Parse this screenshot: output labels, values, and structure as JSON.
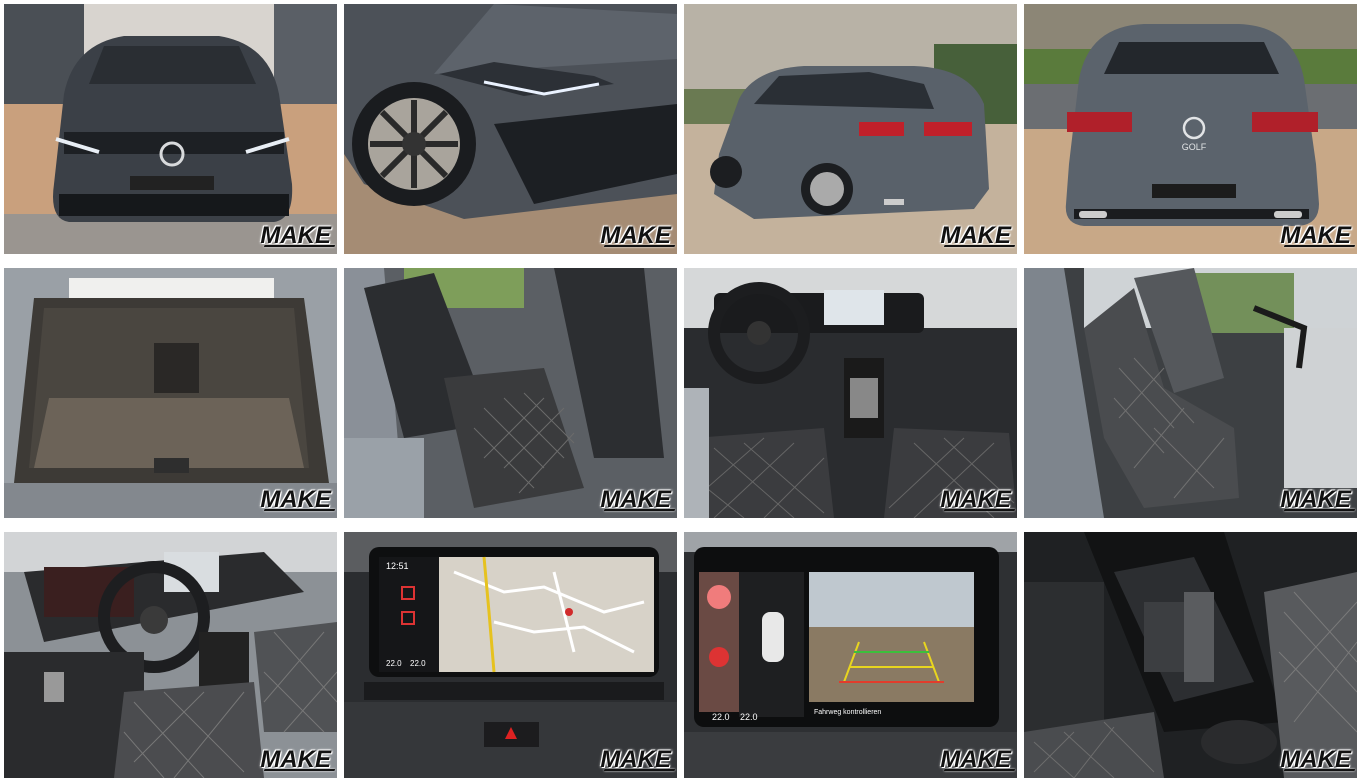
{
  "gallery": {
    "watermark": "MAKE",
    "tiles": [
      {
        "name": "front-exterior"
      },
      {
        "name": "front-headlight-wheel"
      },
      {
        "name": "rear-quarter-exterior"
      },
      {
        "name": "rear-exterior"
      },
      {
        "name": "trunk"
      },
      {
        "name": "rear-seats"
      },
      {
        "name": "dashboard-front-seats"
      },
      {
        "name": "driver-seat-side"
      },
      {
        "name": "cockpit-steering-wheel"
      },
      {
        "name": "navigation-screen"
      },
      {
        "name": "rear-camera-screen"
      },
      {
        "name": "center-console"
      }
    ],
    "rear_badge": "GOLF",
    "screen_time": "12:51",
    "screen_temp_left": "22.0",
    "screen_temp_right": "22.0",
    "camera_caption": "Fahrweg kontrollieren",
    "camera_temp_left": "22.0",
    "camera_temp_right": "22.0"
  }
}
